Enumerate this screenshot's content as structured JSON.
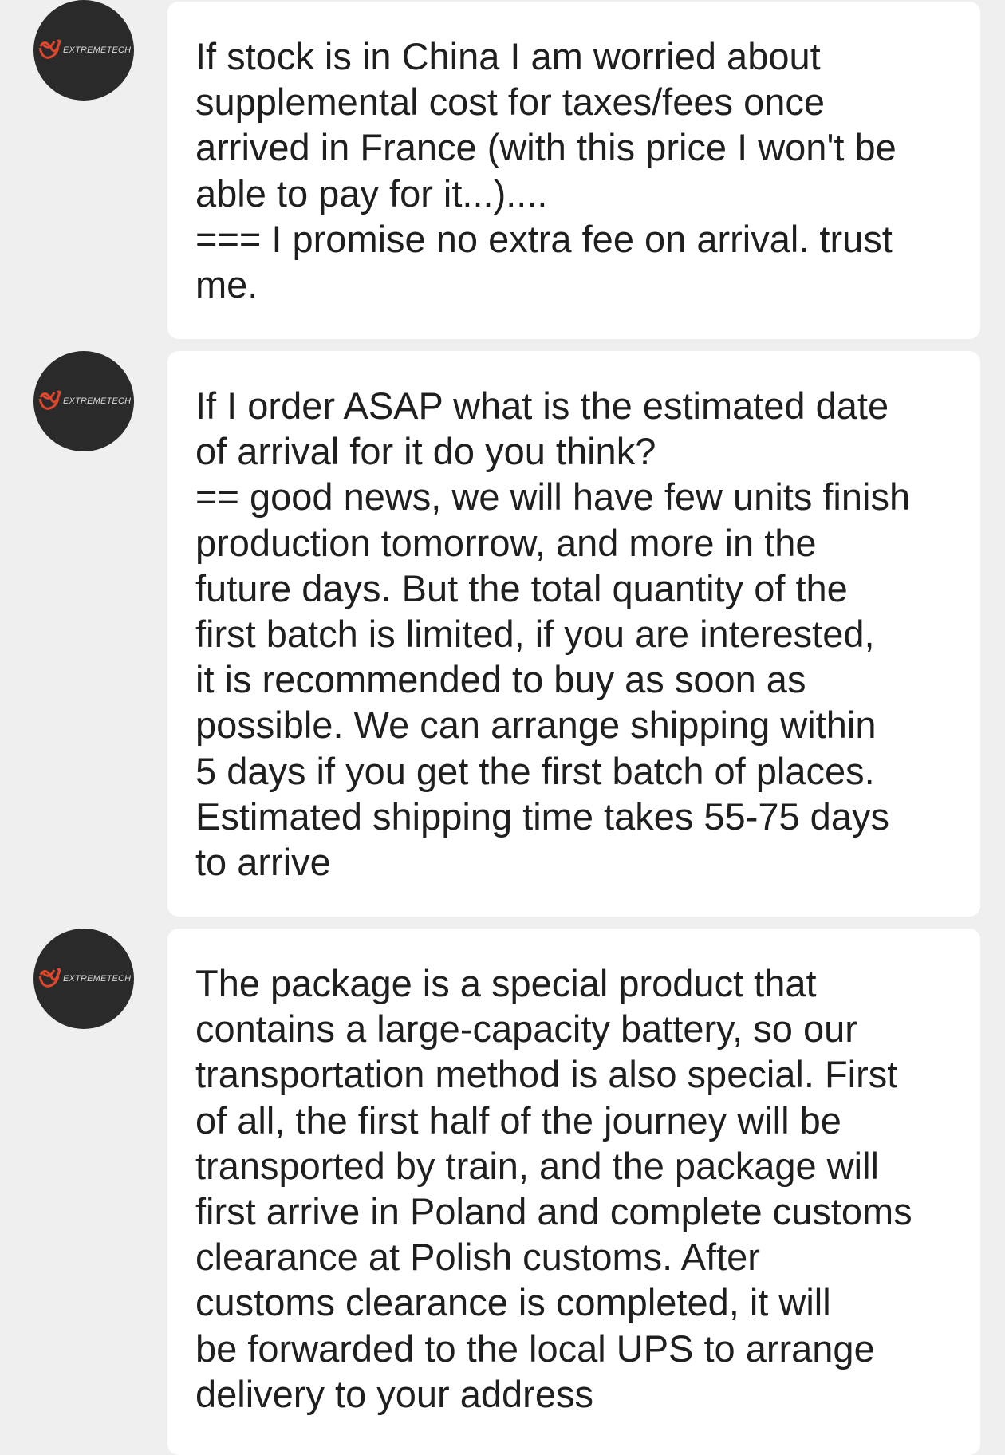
{
  "messages": [
    {
      "sender": "EXTREMETECH",
      "text": "If stock is in China I am worried about\nsupplemental cost for taxes/fees once\narrived in France (with this price I won't be\nable to pay for it...)....\n=== I promise no extra fee on arrival. trust\nme."
    },
    {
      "sender": "EXTREMETECH",
      "text": "If I order ASAP what is the estimated date\nof arrival for it do you think?\n== good news, we will have few units finish\nproduction tomorrow, and more in the\nfuture days. But the total quantity of the\nfirst batch is limited, if you are interested,\nit is recommended to buy as soon as\npossible. We can arrange shipping within\n5 days if you get the first batch of places.\nEstimated shipping time takes 55-75 days\nto arrive"
    },
    {
      "sender": "EXTREMETECH",
      "text": "The package is a special product that\ncontains a large-capacity battery, so our\ntransportation method is also special. First\nof all, the first half of the journey will be\ntransported by train, and the package will\nfirst arrive in Poland and complete customs\nclearance at Polish customs. After\ncustoms clearance is completed, it will\nbe forwarded to the local UPS to arrange\ndelivery to your address"
    }
  ],
  "colors": {
    "background": "#efefef",
    "bubble": "#ffffff",
    "avatar": "#2b2a2a",
    "logo_accent": "#e0472c",
    "text": "#1f1f1f"
  }
}
